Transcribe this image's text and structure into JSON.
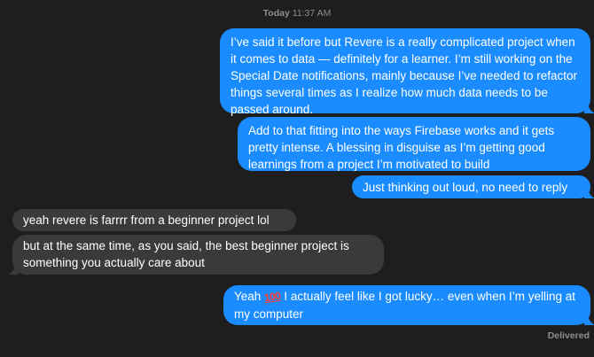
{
  "header": {
    "day": "Today",
    "time": "11:37 AM"
  },
  "messages": [
    {
      "direction": "sent",
      "text": "I’ve said it before but Revere is a really complicated project when it comes to data — definitely for a learner. I’m still working on the Special Date notifications, mainly because I’ve needed to refactor things several times as I realize how much data needs to be passed around."
    },
    {
      "direction": "sent",
      "text": "Add to that fitting into the ways Firebase works and it gets pretty intense. A blessing in disguise as I’m getting good learnings from a project I’m motivated to build"
    },
    {
      "direction": "sent",
      "text": "Just thinking out loud, no need to reply"
    },
    {
      "direction": "received",
      "text": "yeah revere is farrrr from a beginner project lol"
    },
    {
      "direction": "received",
      "text": "but at the same time, as you said, the best beginner project is something you actually care about"
    },
    {
      "direction": "sent",
      "text_before_emoji": "Yeah ",
      "emoji": "100",
      "emoji_name": "hundred-points-emoji",
      "text_after_emoji": " I actually feel like I got lucky… even when I’m yelling at my computer"
    }
  ],
  "status": {
    "label": "Delivered"
  },
  "colors": {
    "background": "#1e1e1e",
    "sent_bubble": "#1a8cff",
    "received_bubble": "#3a3a3c",
    "meta_text": "#8e8e93"
  }
}
